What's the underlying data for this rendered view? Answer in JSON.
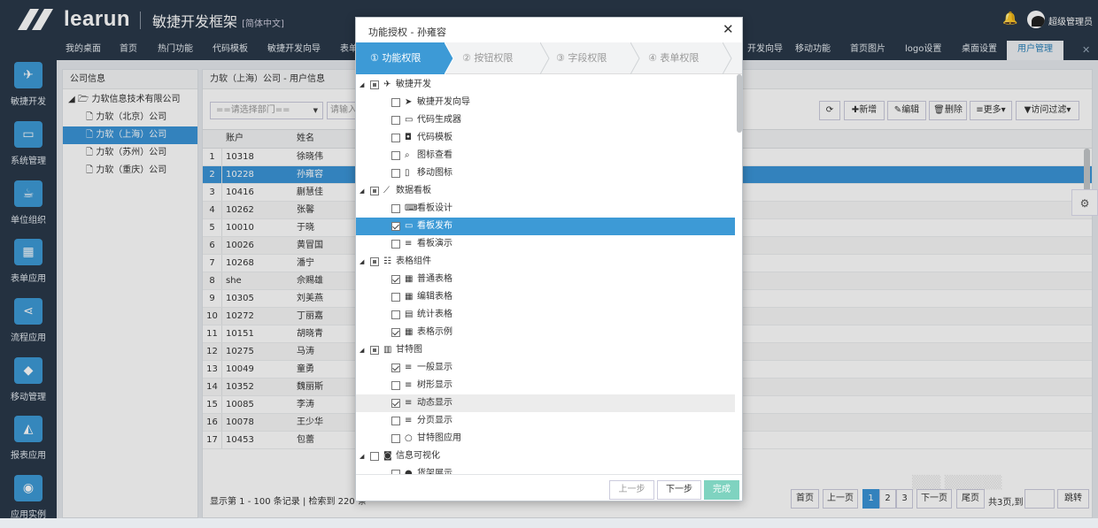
{
  "header": {
    "logo": "learun",
    "app_name": "敏捷开发框架",
    "edition": "[简体中文]",
    "username": "超级管理员"
  },
  "nav_tabs": [
    "我的桌面",
    "首页",
    "热门功能",
    "代码模板",
    "敏捷开发向导",
    "表单",
    "开发向导",
    "移动功能",
    "首页图片",
    "logo设置",
    "桌面设置",
    "用户管理"
  ],
  "sidebar": [
    {
      "label": "敏捷开发",
      "icon": "paper-plane-icon"
    },
    {
      "label": "系统管理",
      "icon": "monitor-icon"
    },
    {
      "label": "单位组织",
      "icon": "coffee-cup-icon"
    },
    {
      "label": "表单应用",
      "icon": "table-icon"
    },
    {
      "label": "流程应用",
      "icon": "share-icon"
    },
    {
      "label": "移动管理",
      "icon": "android-icon"
    },
    {
      "label": "报表应用",
      "icon": "area-chart-icon"
    },
    {
      "label": "应用实例",
      "icon": "globe-icon"
    }
  ],
  "company_panel": {
    "title": "公司信息",
    "root": "力软信息技术有限公司",
    "children": [
      "力软（北京）公司",
      "力软（上海）公司",
      "力软（苏州）公司",
      "力软（重庆）公司"
    ],
    "selected_index": 1
  },
  "user_panel": {
    "title": "力软（上海）公司 - 用户信息",
    "dept_placeholder": "==请选择部门==",
    "keyword_placeholder": "请输入",
    "columns": [
      "账户",
      "姓名"
    ],
    "rows": [
      [
        "1",
        "10318",
        "徐晓伟"
      ],
      [
        "2",
        "10228",
        "孙雍容"
      ],
      [
        "3",
        "10416",
        "蒯慧佳"
      ],
      [
        "4",
        "10262",
        "张馨"
      ],
      [
        "5",
        "10010",
        "于晓"
      ],
      [
        "6",
        "10026",
        "黄冒国"
      ],
      [
        "7",
        "10268",
        "潘宁"
      ],
      [
        "8",
        "she",
        "佘赐雄"
      ],
      [
        "9",
        "10305",
        "刘美燕"
      ],
      [
        "10",
        "10272",
        "丁丽嘉"
      ],
      [
        "11",
        "10151",
        "胡晓青"
      ],
      [
        "12",
        "10275",
        "马涛"
      ],
      [
        "13",
        "10049",
        "童勇"
      ],
      [
        "14",
        "10352",
        "魏丽斯"
      ],
      [
        "15",
        "10085",
        "李涛"
      ],
      [
        "16",
        "10078",
        "王少华"
      ],
      [
        "17",
        "10453",
        "包蕾"
      ]
    ],
    "selected_row": 1,
    "footer": "显示第 1 - 100 条记录 | 检索到 220 条",
    "toolbar": {
      "refresh": "⟳",
      "add": "新增",
      "edit": "编辑",
      "delete": "删除",
      "more": "更多",
      "filter": "访问过滤"
    }
  },
  "pager": {
    "first": "首页",
    "prev": "上一页",
    "pages": [
      "1",
      "2",
      "3"
    ],
    "next": "下一页",
    "last": "尾页",
    "total": "共3页,到",
    "jump": "跳转"
  },
  "dialog": {
    "title": "功能授权 - 孙雍容",
    "steps": [
      {
        "num": "①",
        "label": "功能权限"
      },
      {
        "num": "②",
        "label": "按钮权限"
      },
      {
        "num": "③",
        "label": "字段权限"
      },
      {
        "num": "④",
        "label": "表单权限"
      }
    ],
    "active_step": 0,
    "tree": [
      {
        "level": 0,
        "toggle": "◢",
        "state": "part",
        "icon": "paper-plane-icon",
        "glyph": "✈",
        "label": "敏捷开发"
      },
      {
        "level": 1,
        "toggle": "",
        "state": "",
        "icon": "send-icon",
        "glyph": "➤",
        "label": "敏捷开发向导"
      },
      {
        "level": 1,
        "toggle": "",
        "state": "",
        "icon": "monitor-icon",
        "glyph": "▭",
        "label": "代码生成器"
      },
      {
        "level": 1,
        "toggle": "",
        "state": "",
        "icon": "code-icon",
        "glyph": "◘",
        "label": "代码模板"
      },
      {
        "level": 1,
        "toggle": "",
        "state": "",
        "icon": "search-icon",
        "glyph": "⌕",
        "label": "图标查看"
      },
      {
        "level": 1,
        "toggle": "",
        "state": "",
        "icon": "mobile-icon",
        "glyph": "▯",
        "label": "移动图标"
      },
      {
        "level": 0,
        "toggle": "◢",
        "state": "part",
        "icon": "line-chart-icon",
        "glyph": "⟋",
        "label": "数据看板"
      },
      {
        "level": 1,
        "toggle": "",
        "state": "",
        "icon": "keyboard-icon",
        "glyph": "⌨",
        "label": "看板设计"
      },
      {
        "level": 1,
        "toggle": "",
        "state": "chk",
        "icon": "laptop-icon",
        "glyph": "▭",
        "label": "看板发布",
        "selected": true
      },
      {
        "level": 1,
        "toggle": "",
        "state": "",
        "icon": "list-icon",
        "glyph": "≡",
        "label": "看板演示"
      },
      {
        "level": 0,
        "toggle": "◢",
        "state": "part",
        "icon": "list-alt-icon",
        "glyph": "☷",
        "label": "表格组件"
      },
      {
        "level": 1,
        "toggle": "",
        "state": "chk",
        "icon": "table-icon",
        "glyph": "▦",
        "label": "普通表格"
      },
      {
        "level": 1,
        "toggle": "",
        "state": "",
        "icon": "table-icon",
        "glyph": "▦",
        "label": "编辑表格"
      },
      {
        "level": 1,
        "toggle": "",
        "state": "",
        "icon": "file-icon",
        "glyph": "▤",
        "label": "统计表格"
      },
      {
        "level": 1,
        "toggle": "",
        "state": "chk",
        "icon": "table-icon",
        "glyph": "▦",
        "label": "表格示例"
      },
      {
        "level": 0,
        "toggle": "◢",
        "state": "part",
        "icon": "bar-chart-icon",
        "glyph": "▥",
        "label": "甘特图"
      },
      {
        "level": 1,
        "toggle": "",
        "state": "chk",
        "icon": "list-icon",
        "glyph": "≡",
        "label": "一般显示"
      },
      {
        "level": 1,
        "toggle": "",
        "state": "",
        "icon": "list-icon",
        "glyph": "≡",
        "label": "树形显示"
      },
      {
        "level": 1,
        "toggle": "",
        "state": "chk",
        "icon": "list-icon",
        "glyph": "≡",
        "label": "动态显示",
        "hover": true
      },
      {
        "level": 1,
        "toggle": "",
        "state": "",
        "icon": "list-icon",
        "glyph": "≡",
        "label": "分页显示"
      },
      {
        "level": 1,
        "toggle": "",
        "state": "",
        "icon": "circle-icon",
        "glyph": "○",
        "label": "甘特图应用"
      },
      {
        "level": 0,
        "toggle": "◢",
        "state": "",
        "icon": "camera-icon",
        "glyph": "◙",
        "label": "信息可视化"
      },
      {
        "level": 1,
        "toggle": "",
        "state": "",
        "icon": "dashboard-icon",
        "glyph": "●",
        "label": "货架展示"
      }
    ],
    "buttons": {
      "prev": "上一步",
      "next": "下一步",
      "finish": "完成"
    }
  },
  "colors": {
    "accent": "#3d9ad6",
    "header_bg": "#2a3849",
    "finish": "#7fd3c0"
  }
}
